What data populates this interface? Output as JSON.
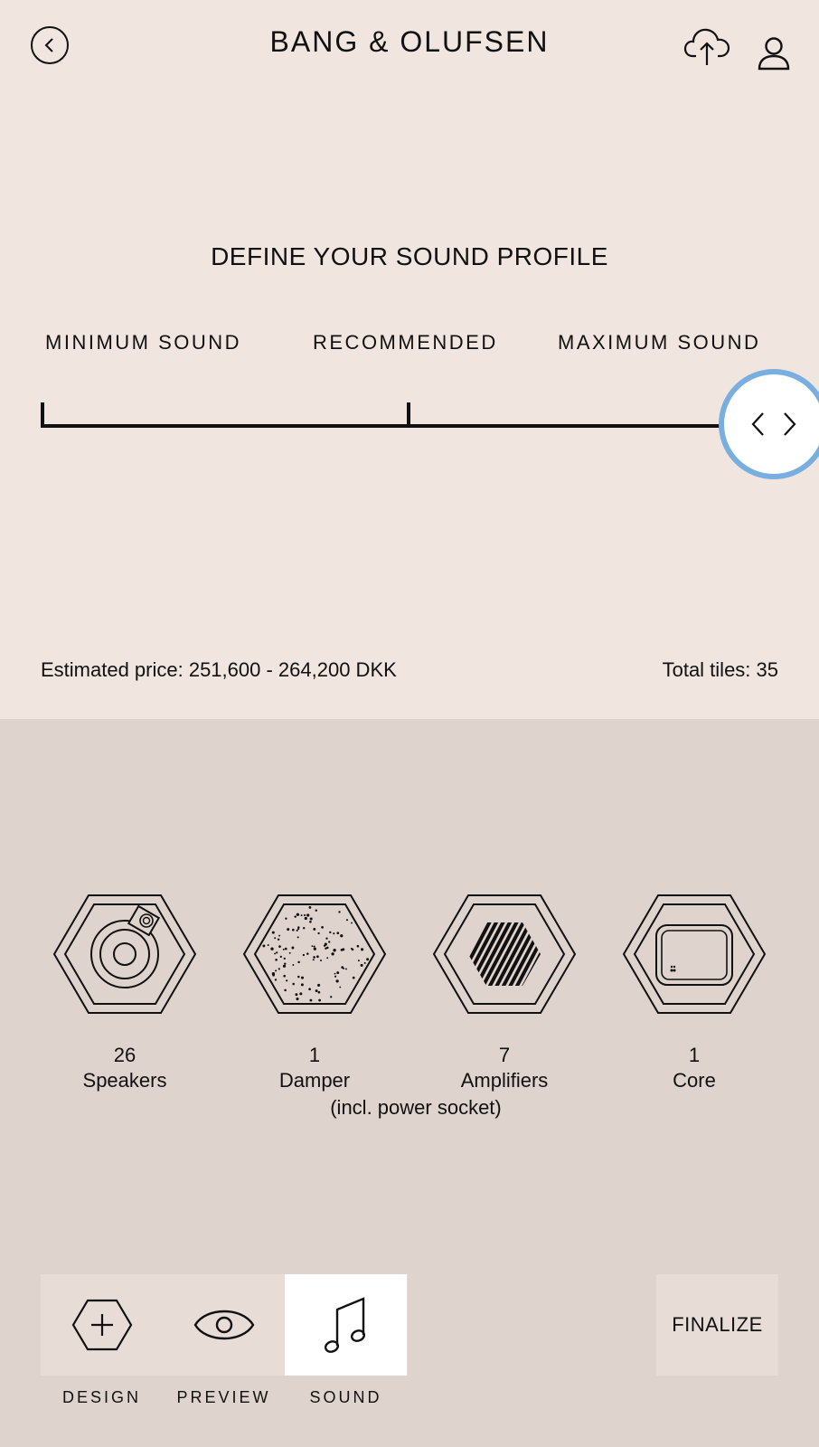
{
  "header": {
    "brand": "BANG & OLUFSEN",
    "back_icon": "chevron-left-icon",
    "cloud_icon": "cloud-upload-icon",
    "user_icon": "user-icon"
  },
  "sound_profile": {
    "title": "DEFINE YOUR SOUND PROFILE",
    "labels": {
      "min": "MINIMUM SOUND",
      "recommended": "RECOMMENDED",
      "max": "MAXIMUM SOUND"
    },
    "slider_value": 1.0,
    "accent_color": "#78aee0"
  },
  "summary": {
    "price": "Estimated price: 251,600 - 264,200 DKK",
    "tiles": "Total tiles: 35"
  },
  "components": [
    {
      "count": "26",
      "label": "Speakers",
      "icon": "speaker-tile-icon"
    },
    {
      "count": "1",
      "label": "Damper",
      "note": "(incl. power socket)",
      "icon": "damper-tile-icon"
    },
    {
      "count": "7",
      "label": "Amplifiers",
      "icon": "amplifier-tile-icon"
    },
    {
      "count": "1",
      "label": "Core",
      "icon": "core-tile-icon"
    }
  ],
  "nav": {
    "tabs": [
      {
        "label": "DESIGN",
        "icon": "hexagon-plus-icon"
      },
      {
        "label": "PREVIEW",
        "icon": "eye-icon"
      },
      {
        "label": "SOUND",
        "icon": "music-note-icon",
        "active": true
      }
    ],
    "finalize": "FINALIZE"
  }
}
